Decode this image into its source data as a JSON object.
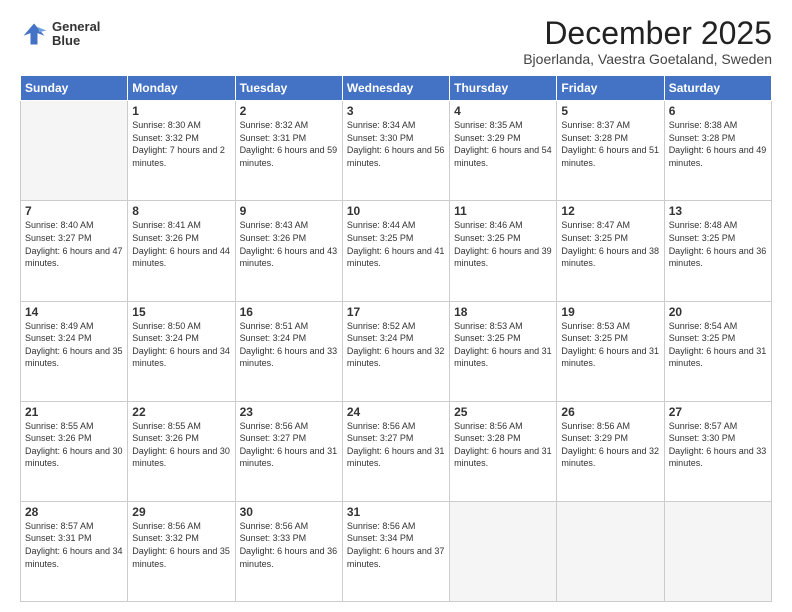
{
  "header": {
    "logo_line1": "General",
    "logo_line2": "Blue",
    "title": "December 2025",
    "subtitle": "Bjoerlanda, Vaestra Goetaland, Sweden"
  },
  "days_of_week": [
    "Sunday",
    "Monday",
    "Tuesday",
    "Wednesday",
    "Thursday",
    "Friday",
    "Saturday"
  ],
  "weeks": [
    [
      {
        "day": "",
        "sunrise": "",
        "sunset": "",
        "daylight": ""
      },
      {
        "day": "1",
        "sunrise": "Sunrise: 8:30 AM",
        "sunset": "Sunset: 3:32 PM",
        "daylight": "Daylight: 7 hours and 2 minutes."
      },
      {
        "day": "2",
        "sunrise": "Sunrise: 8:32 AM",
        "sunset": "Sunset: 3:31 PM",
        "daylight": "Daylight: 6 hours and 59 minutes."
      },
      {
        "day": "3",
        "sunrise": "Sunrise: 8:34 AM",
        "sunset": "Sunset: 3:30 PM",
        "daylight": "Daylight: 6 hours and 56 minutes."
      },
      {
        "day": "4",
        "sunrise": "Sunrise: 8:35 AM",
        "sunset": "Sunset: 3:29 PM",
        "daylight": "Daylight: 6 hours and 54 minutes."
      },
      {
        "day": "5",
        "sunrise": "Sunrise: 8:37 AM",
        "sunset": "Sunset: 3:28 PM",
        "daylight": "Daylight: 6 hours and 51 minutes."
      },
      {
        "day": "6",
        "sunrise": "Sunrise: 8:38 AM",
        "sunset": "Sunset: 3:28 PM",
        "daylight": "Daylight: 6 hours and 49 minutes."
      }
    ],
    [
      {
        "day": "7",
        "sunrise": "Sunrise: 8:40 AM",
        "sunset": "Sunset: 3:27 PM",
        "daylight": "Daylight: 6 hours and 47 minutes."
      },
      {
        "day": "8",
        "sunrise": "Sunrise: 8:41 AM",
        "sunset": "Sunset: 3:26 PM",
        "daylight": "Daylight: 6 hours and 44 minutes."
      },
      {
        "day": "9",
        "sunrise": "Sunrise: 8:43 AM",
        "sunset": "Sunset: 3:26 PM",
        "daylight": "Daylight: 6 hours and 43 minutes."
      },
      {
        "day": "10",
        "sunrise": "Sunrise: 8:44 AM",
        "sunset": "Sunset: 3:25 PM",
        "daylight": "Daylight: 6 hours and 41 minutes."
      },
      {
        "day": "11",
        "sunrise": "Sunrise: 8:46 AM",
        "sunset": "Sunset: 3:25 PM",
        "daylight": "Daylight: 6 hours and 39 minutes."
      },
      {
        "day": "12",
        "sunrise": "Sunrise: 8:47 AM",
        "sunset": "Sunset: 3:25 PM",
        "daylight": "Daylight: 6 hours and 38 minutes."
      },
      {
        "day": "13",
        "sunrise": "Sunrise: 8:48 AM",
        "sunset": "Sunset: 3:25 PM",
        "daylight": "Daylight: 6 hours and 36 minutes."
      }
    ],
    [
      {
        "day": "14",
        "sunrise": "Sunrise: 8:49 AM",
        "sunset": "Sunset: 3:24 PM",
        "daylight": "Daylight: 6 hours and 35 minutes."
      },
      {
        "day": "15",
        "sunrise": "Sunrise: 8:50 AM",
        "sunset": "Sunset: 3:24 PM",
        "daylight": "Daylight: 6 hours and 34 minutes."
      },
      {
        "day": "16",
        "sunrise": "Sunrise: 8:51 AM",
        "sunset": "Sunset: 3:24 PM",
        "daylight": "Daylight: 6 hours and 33 minutes."
      },
      {
        "day": "17",
        "sunrise": "Sunrise: 8:52 AM",
        "sunset": "Sunset: 3:24 PM",
        "daylight": "Daylight: 6 hours and 32 minutes."
      },
      {
        "day": "18",
        "sunrise": "Sunrise: 8:53 AM",
        "sunset": "Sunset: 3:25 PM",
        "daylight": "Daylight: 6 hours and 31 minutes."
      },
      {
        "day": "19",
        "sunrise": "Sunrise: 8:53 AM",
        "sunset": "Sunset: 3:25 PM",
        "daylight": "Daylight: 6 hours and 31 minutes."
      },
      {
        "day": "20",
        "sunrise": "Sunrise: 8:54 AM",
        "sunset": "Sunset: 3:25 PM",
        "daylight": "Daylight: 6 hours and 31 minutes."
      }
    ],
    [
      {
        "day": "21",
        "sunrise": "Sunrise: 8:55 AM",
        "sunset": "Sunset: 3:26 PM",
        "daylight": "Daylight: 6 hours and 30 minutes."
      },
      {
        "day": "22",
        "sunrise": "Sunrise: 8:55 AM",
        "sunset": "Sunset: 3:26 PM",
        "daylight": "Daylight: 6 hours and 30 minutes."
      },
      {
        "day": "23",
        "sunrise": "Sunrise: 8:56 AM",
        "sunset": "Sunset: 3:27 PM",
        "daylight": "Daylight: 6 hours and 31 minutes."
      },
      {
        "day": "24",
        "sunrise": "Sunrise: 8:56 AM",
        "sunset": "Sunset: 3:27 PM",
        "daylight": "Daylight: 6 hours and 31 minutes."
      },
      {
        "day": "25",
        "sunrise": "Sunrise: 8:56 AM",
        "sunset": "Sunset: 3:28 PM",
        "daylight": "Daylight: 6 hours and 31 minutes."
      },
      {
        "day": "26",
        "sunrise": "Sunrise: 8:56 AM",
        "sunset": "Sunset: 3:29 PM",
        "daylight": "Daylight: 6 hours and 32 minutes."
      },
      {
        "day": "27",
        "sunrise": "Sunrise: 8:57 AM",
        "sunset": "Sunset: 3:30 PM",
        "daylight": "Daylight: 6 hours and 33 minutes."
      }
    ],
    [
      {
        "day": "28",
        "sunrise": "Sunrise: 8:57 AM",
        "sunset": "Sunset: 3:31 PM",
        "daylight": "Daylight: 6 hours and 34 minutes."
      },
      {
        "day": "29",
        "sunrise": "Sunrise: 8:56 AM",
        "sunset": "Sunset: 3:32 PM",
        "daylight": "Daylight: 6 hours and 35 minutes."
      },
      {
        "day": "30",
        "sunrise": "Sunrise: 8:56 AM",
        "sunset": "Sunset: 3:33 PM",
        "daylight": "Daylight: 6 hours and 36 minutes."
      },
      {
        "day": "31",
        "sunrise": "Sunrise: 8:56 AM",
        "sunset": "Sunset: 3:34 PM",
        "daylight": "Daylight: 6 hours and 37 minutes."
      },
      {
        "day": "",
        "sunrise": "",
        "sunset": "",
        "daylight": ""
      },
      {
        "day": "",
        "sunrise": "",
        "sunset": "",
        "daylight": ""
      },
      {
        "day": "",
        "sunrise": "",
        "sunset": "",
        "daylight": ""
      }
    ]
  ]
}
